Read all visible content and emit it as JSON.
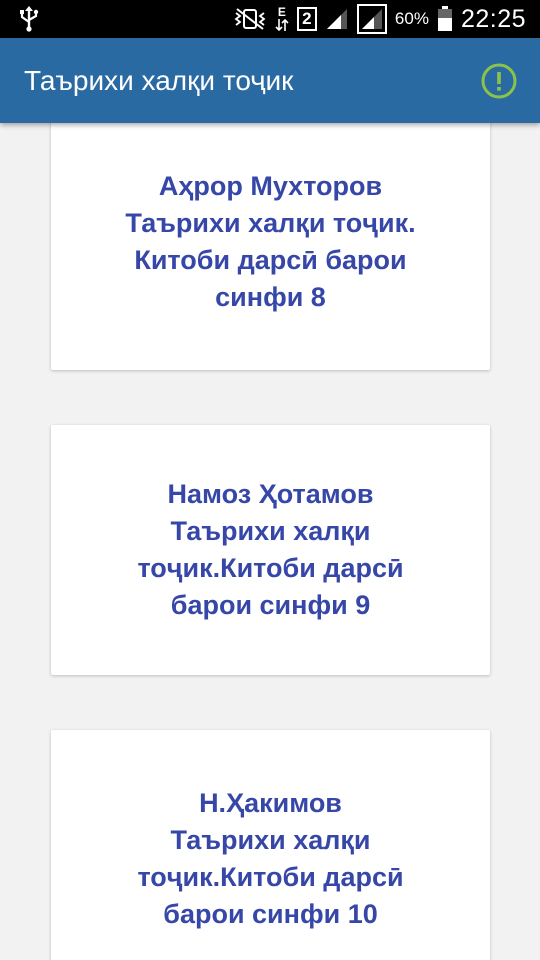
{
  "status_bar": {
    "battery_percent": "60%",
    "time": "22:25",
    "sim_slot": "2",
    "network_type": "E",
    "icons": [
      "usb-icon",
      "mute-vibrate-icon",
      "data-arrows-icon",
      "signal-icon",
      "battery-icon"
    ]
  },
  "app_bar": {
    "title": "Таърихи халқи тоҷик",
    "info_icon": "info-exclamation-icon",
    "background_color": "#2a6aa3",
    "info_icon_color": "#8bc34a"
  },
  "books": [
    {
      "lines": [
        "Аҳрор Мухторов",
        "Таърихи халқи тоҷик.",
        "Китоби дарсӣ барои",
        "синфи 8"
      ]
    },
    {
      "lines": [
        "Намоз Ҳотамов",
        "Таърихи халқи",
        "тоҷик.Китоби дарсӣ",
        "барои синфи 9"
      ]
    },
    {
      "lines": [
        "Н.Ҳакимов",
        "Таърихи халқи",
        "тоҷик.Китоби дарсӣ",
        "барои синфи 10"
      ]
    }
  ],
  "colors": {
    "card_text": "#3647a8",
    "background": "#f2f2f2"
  }
}
